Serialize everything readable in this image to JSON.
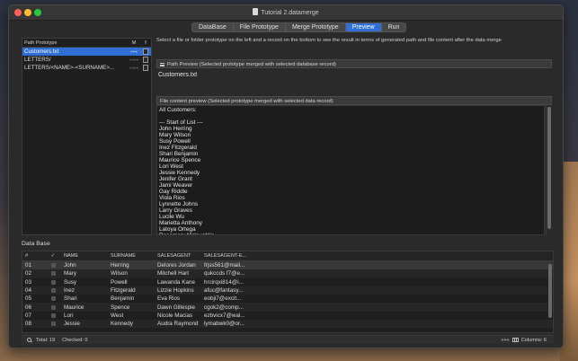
{
  "window": {
    "title": "Tutorial 2.datamerge"
  },
  "tabs": [
    {
      "label": "DataBase",
      "active": false
    },
    {
      "label": "File Prototype",
      "active": false
    },
    {
      "label": "Merge Prototype",
      "active": false
    },
    {
      "label": "Preview",
      "active": true
    },
    {
      "label": "Run",
      "active": false
    }
  ],
  "prototype_panel": {
    "header": {
      "name": "Path Prototype",
      "m": "M",
      "f": "f"
    },
    "rows": [
      {
        "name": "Customers.txt",
        "m": "»+«",
        "selected": true
      },
      {
        "name": "LETTERS/",
        "m": "»»»»",
        "selected": false
      },
      {
        "name": "LETTERS/<NAME>-<SURNAME>...",
        "m": "»»»»",
        "selected": false
      }
    ]
  },
  "instruction": "Select a file or folder prototype  on the left and a record on the bottom to see the result in terms of generated path and file content after the data merge",
  "path_preview": {
    "title": "Path Preview (Selected prototype merged with selected database record)",
    "value": "Customers.txt"
  },
  "file_preview": {
    "title": "File content preview (Selected prototype merged with selected data record)",
    "lines": [
      "All Customers:",
      "",
      "--- Start of List ---",
      "John Herring",
      "Mary Wilson",
      "Susy Powell",
      "Inez Fitzgerald",
      "Shari Benjamin",
      "Maurice Spence",
      "Lori West",
      "Jessie Kennedy",
      "Jenifer Grant",
      "Jami Weaver",
      "Gay Riddle",
      "Viola Rios",
      "Lynnette Johns",
      "Larry Graves",
      "Lucile Wu",
      "Marietta Anthony",
      "Latoya Ortega",
      "Rosemary Mclaughlin"
    ]
  },
  "database": {
    "label": "Data Base",
    "columns": [
      "#",
      "✓",
      "NAME",
      "SURNAME",
      "SALESAGENT",
      "SALESAGENT-E..."
    ],
    "rows": [
      [
        "01",
        "",
        "John",
        "Herring",
        "Delores Jordan",
        "frjss561@mail..."
      ],
      [
        "02",
        "",
        "Mary",
        "Wilson",
        "Mitchell Hart",
        "qukccds f7@e..."
      ],
      [
        "03",
        "",
        "Susy",
        "Powell",
        "Lawanda Kane",
        "hrcirqxi814@i..."
      ],
      [
        "04",
        "",
        "Inez",
        "Fitzgerald",
        "Lizzie Hopkins",
        "afuc@fantasy..."
      ],
      [
        "05",
        "",
        "Shari",
        "Benjamin",
        "Eva Rios",
        "eobji7@excit..."
      ],
      [
        "06",
        "",
        "Maurice",
        "Spence",
        "Dawn Gillespie",
        "cgok2@comp..."
      ],
      [
        "07",
        "",
        "Lori",
        "West",
        "Nicole Macias",
        "ezbvicx7@wal..."
      ],
      [
        "08",
        "",
        "Jessie",
        "Kennedy",
        "Audra Raymond",
        "lymabwk0@or..."
      ]
    ]
  },
  "status": {
    "total": "Total: 19",
    "checked": "Checked: 0",
    "arrows": "»+«",
    "columns": "Columns: 6"
  }
}
